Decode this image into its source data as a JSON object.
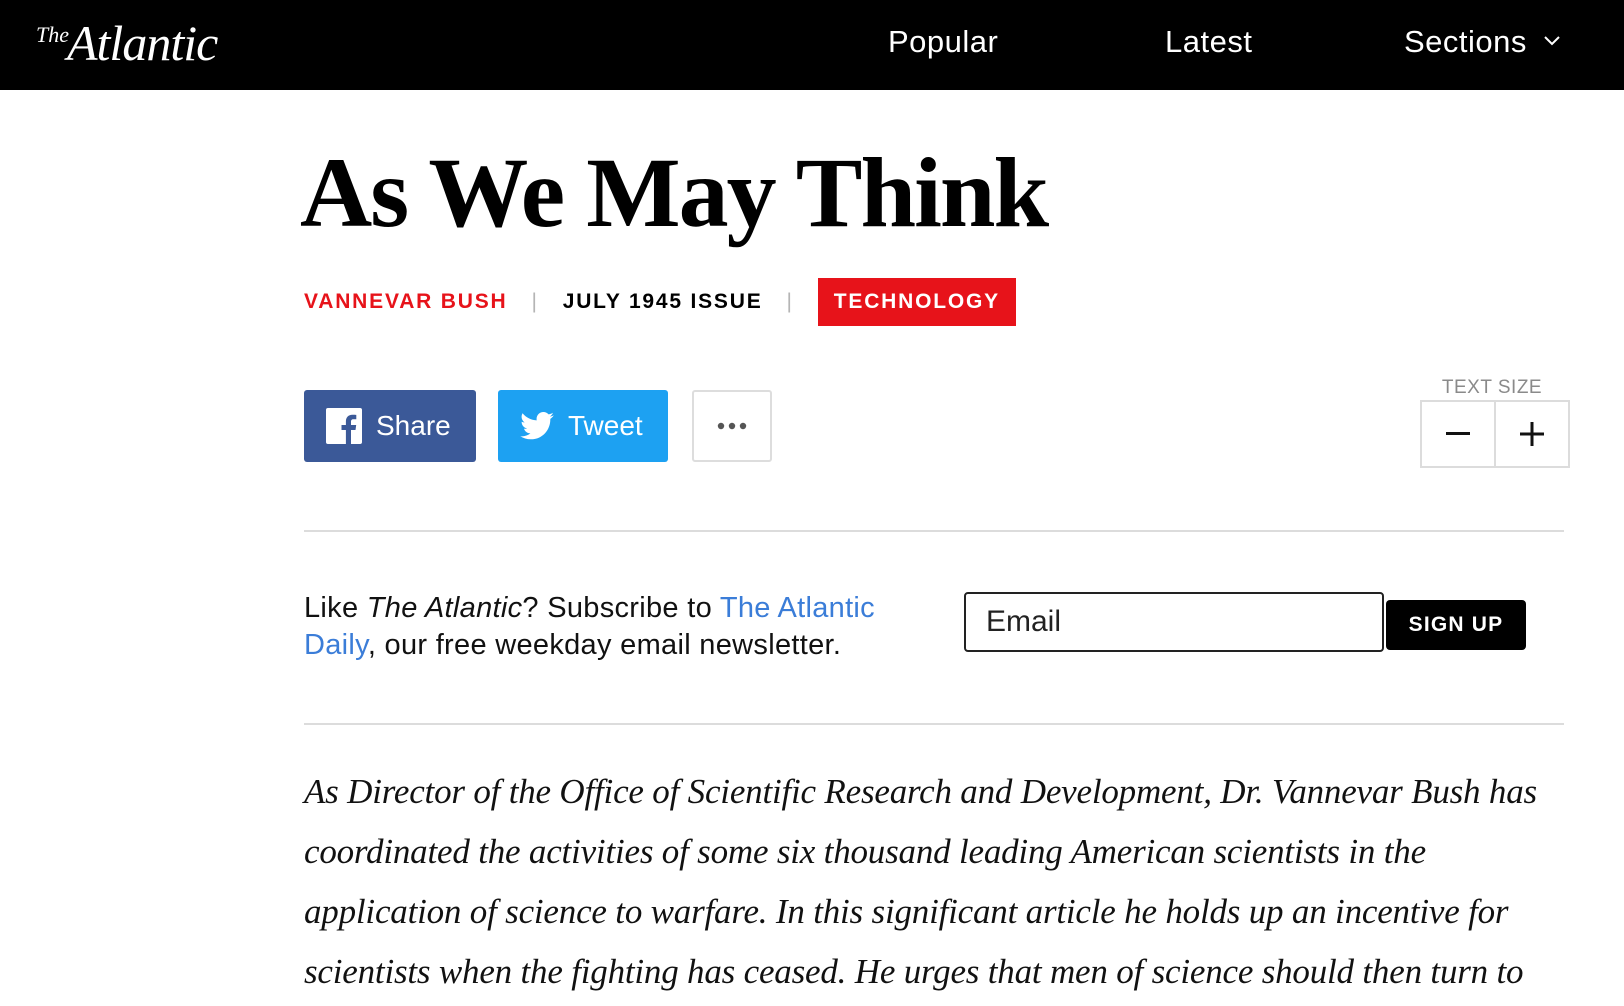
{
  "header": {
    "logo": {
      "the": "The",
      "name": "Atlantic"
    },
    "nav": {
      "popular": "Popular",
      "latest": "Latest",
      "sections": "Sections"
    }
  },
  "article": {
    "title": "As We May Think",
    "author": "VANNEVAR BUSH",
    "issue": "JULY 1945 ISSUE",
    "tag": "TECHNOLOGY",
    "intro": "As Director of the Office of Scientific Research and Development, Dr. Vannevar Bush has coordinated the activities of some six thousand leading American scientists in the application of science to warfare. In this significant article he holds up an incentive for scientists when the fighting has ceased. He urges that men of science should then turn to"
  },
  "share": {
    "facebook_label": "Share",
    "twitter_label": "Tweet",
    "more_icon": "ellipsis-icon"
  },
  "text_size": {
    "label": "TEXT SIZE",
    "decrease": "−",
    "increase": "+"
  },
  "newsletter": {
    "text_1": "Like ",
    "text_brand": "The Atlantic",
    "text_2": "? Subscribe to ",
    "link": "The Atlantic Daily",
    "text_3": ", our free weekday email newsletter.",
    "email_placeholder": "Email",
    "signup_label": "SIGN UP"
  },
  "colors": {
    "accent_red": "#e7131a",
    "facebook_blue": "#3b5998",
    "twitter_blue": "#1da1f2",
    "link_blue": "#3b7dd8",
    "topbar": "#000000"
  }
}
